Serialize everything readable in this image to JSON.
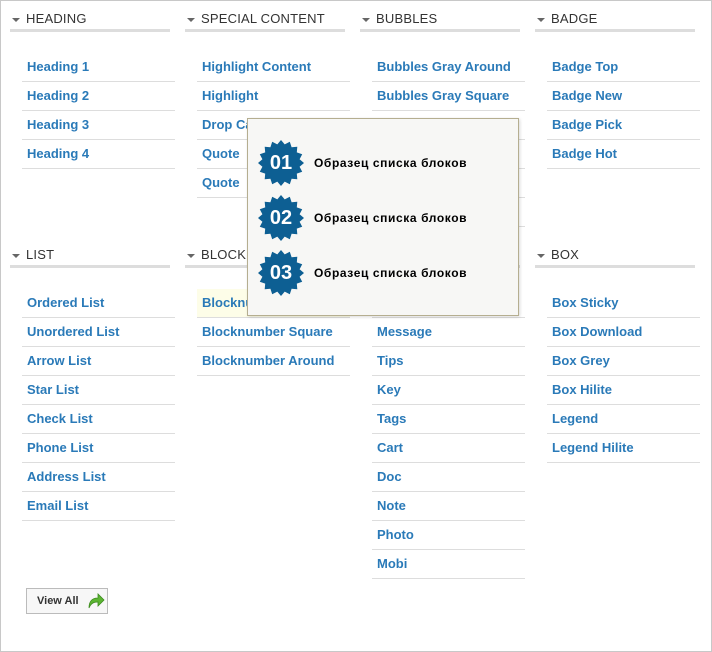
{
  "sections_top": [
    {
      "title": "HEADING",
      "items": [
        "Heading 1",
        "Heading 2",
        "Heading 3",
        "Heading 4"
      ]
    },
    {
      "title": "SPECIAL CONTENT",
      "items": [
        "Highlight Content",
        "Highlight",
        "Drop Caps",
        "Quote",
        "Quote"
      ]
    },
    {
      "title": "BUBBLES",
      "items": [
        "Bubbles Gray Around",
        "Bubbles Gray Square",
        "",
        "",
        "",
        ""
      ]
    },
    {
      "title": "BADGE",
      "items": [
        "Badge Top",
        "Badge New",
        "Badge Pick",
        "Badge Hot"
      ]
    }
  ],
  "sections_bottom": [
    {
      "title": "LIST",
      "items": [
        "Ordered List",
        "Unordered List",
        "Arrow List",
        "Star List",
        "Check List",
        "Phone List",
        "Address List",
        "Email List"
      ]
    },
    {
      "title": "BLOCKNUMBER",
      "items": [
        "Blocknumber",
        "Blocknumber Square",
        "Blocknumber Around"
      ]
    },
    {
      "title": "",
      "items": [
        "",
        "Message",
        "Tips",
        "Key",
        "Tags",
        "Cart",
        "Doc",
        "Note",
        "Photo",
        "Mobi"
      ]
    },
    {
      "title": "BOX",
      "items": [
        "Box Sticky",
        "Box Download",
        "Box Grey",
        "Box Hilite",
        "Legend",
        "Legend Hilite"
      ]
    }
  ],
  "popup": {
    "items": [
      {
        "num": "01",
        "text": "Образец списка блоков"
      },
      {
        "num": "02",
        "text": "Образец списка блоков"
      },
      {
        "num": "03",
        "text": "Образец списка блоков"
      }
    ],
    "badge_color": "#0d5f93"
  },
  "view_all": {
    "label": "View All",
    "icon": "green-arrow-icon"
  },
  "colors": {
    "link": "#2a7ab8",
    "heading": "#333333"
  }
}
